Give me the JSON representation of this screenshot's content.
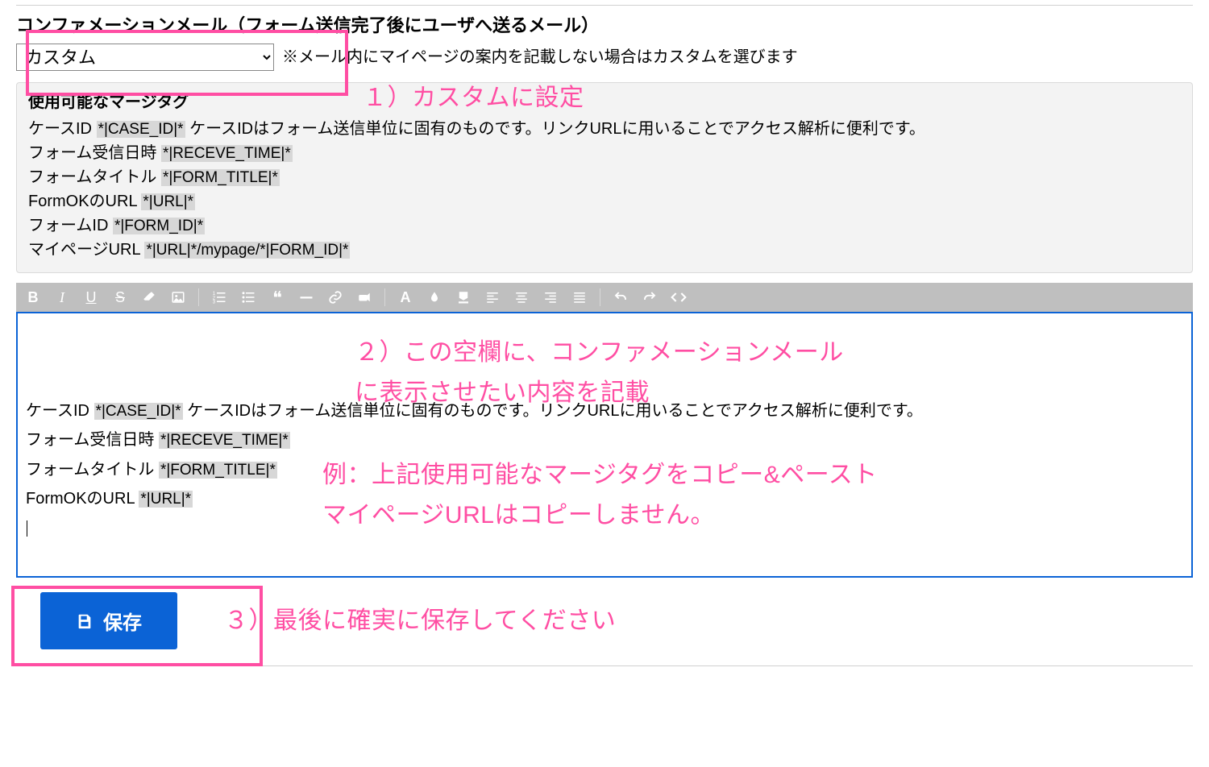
{
  "section": {
    "title": "コンファメーションメール（フォーム送信完了後にユーザへ送るメール）",
    "select_value": "カスタム",
    "select_hint": "※メール内にマイページの案内を記載しない場合はカスタムを選びます"
  },
  "annotations": {
    "a1": "１）カスタムに設定",
    "a2": "２）この空欄に、コンファメーションメールに表示させたい内容を記載",
    "a2_line1": "２）この空欄に、コンファメーションメール",
    "a2_line2": "に表示させたい内容を記載",
    "a2b_line1": "例：上記使用可能なマージタグをコピー&ペースト",
    "a2b_line2": "マイページURLはコピーしません。",
    "a3": "３）最後に確実に保存してください"
  },
  "merge": {
    "heading": "使用可能なマージタグ",
    "rows": [
      {
        "label": "ケースID",
        "tag": "*|CASE_ID|*",
        "desc": " ケースIDはフォーム送信単位に固有のものです。リンクURLに用いることでアクセス解析に便利です。"
      },
      {
        "label": "フォーム受信日時",
        "tag": "*|RECEVE_TIME|*",
        "desc": ""
      },
      {
        "label": "フォームタイトル",
        "tag": "*|FORM_TITLE|*",
        "desc": ""
      },
      {
        "label": "FormOKのURL",
        "tag": "*|URL|*",
        "desc": ""
      },
      {
        "label": "フォームID",
        "tag": "*|FORM_ID|*",
        "desc": ""
      },
      {
        "label": "マイページURL",
        "tag": "*|URL|*/mypage/*|FORM_ID|*",
        "desc": ""
      }
    ]
  },
  "toolbar": {
    "buttons": [
      "bold",
      "italic",
      "underline",
      "strike",
      "eraser",
      "image",
      "ol",
      "ul",
      "quote",
      "hr",
      "link",
      "unlink",
      "color",
      "drop",
      "fill",
      "align-left",
      "align-center",
      "align-right",
      "align-justify",
      "undo",
      "redo",
      "code"
    ]
  },
  "editor": {
    "lines": [
      {
        "label": "ケースID",
        "tag": "*|CASE_ID|*",
        "desc": " ケースIDはフォーム送信単位に固有のものです。リンクURLに用いることでアクセス解析に便利です。"
      },
      {
        "label": "フォーム受信日時",
        "tag": "*|RECEVE_TIME|*",
        "desc": ""
      },
      {
        "label": "フォームタイトル",
        "tag": "*|FORM_TITLE|*",
        "desc": ""
      },
      {
        "label": "FormOKのURL",
        "tag": "*|URL|*",
        "desc": ""
      }
    ]
  },
  "save": {
    "label": "保存"
  }
}
